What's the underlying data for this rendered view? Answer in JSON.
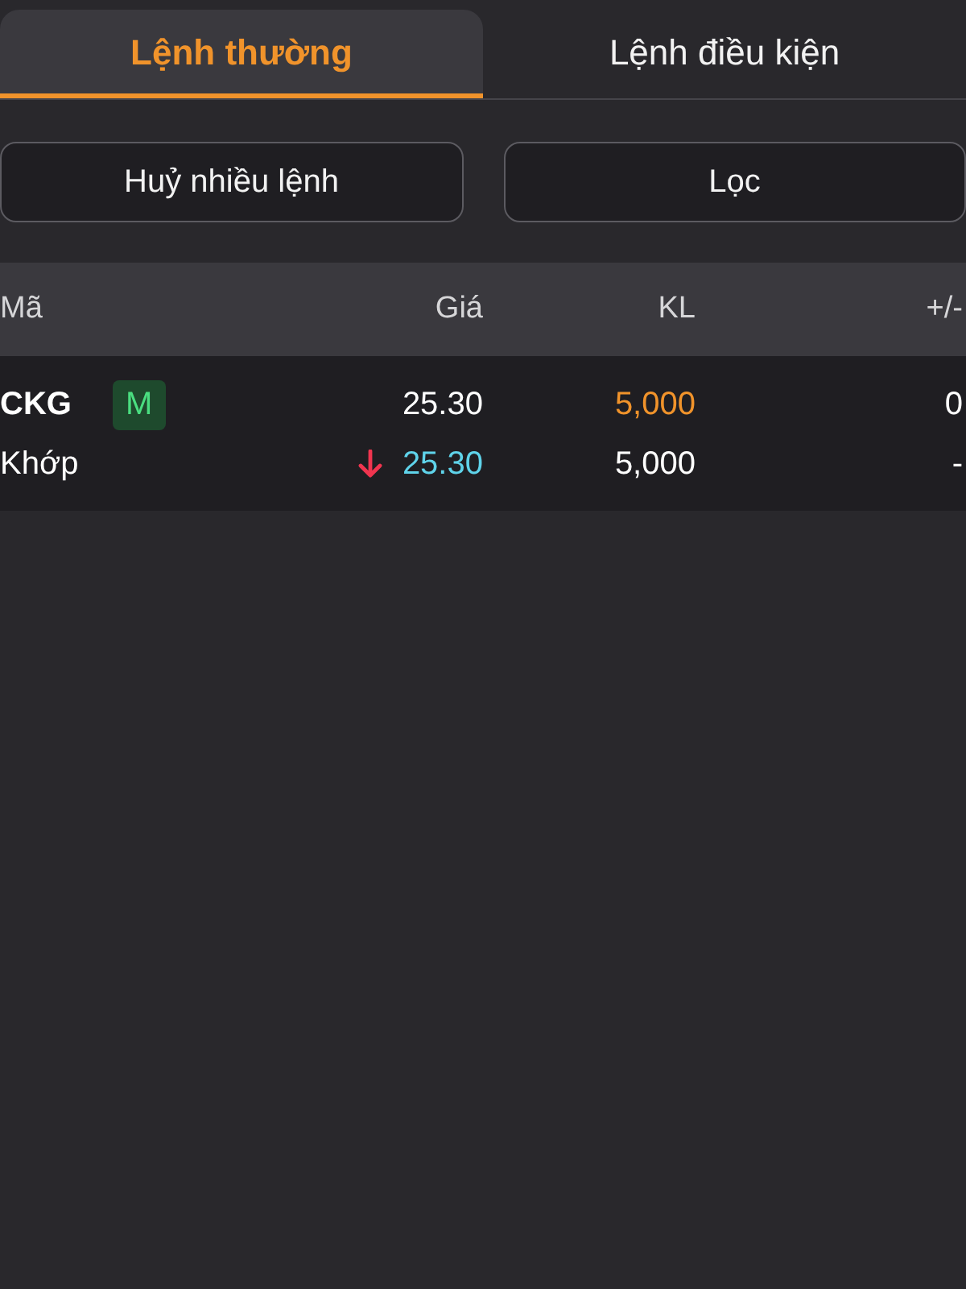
{
  "tabs": [
    {
      "label": "Lệnh thường",
      "selected": true
    },
    {
      "label": "Lệnh điều kiện",
      "selected": false
    }
  ],
  "buttons": [
    "Huỷ nhiều lệnh",
    "Lọc"
  ],
  "table": {
    "columns": [
      "Mã",
      "Giá",
      "KL",
      "+/-"
    ],
    "rows": [
      {
        "symbol": "CKG",
        "badge": "M",
        "price": "25.30",
        "volume": "5,000",
        "change": "0",
        "status": "Khớp",
        "trend_arrow": {
          "kind": "down"
        },
        "matched_price": "25.30",
        "matched_volume": "5,000",
        "matched_change": "-"
      }
    ]
  }
}
